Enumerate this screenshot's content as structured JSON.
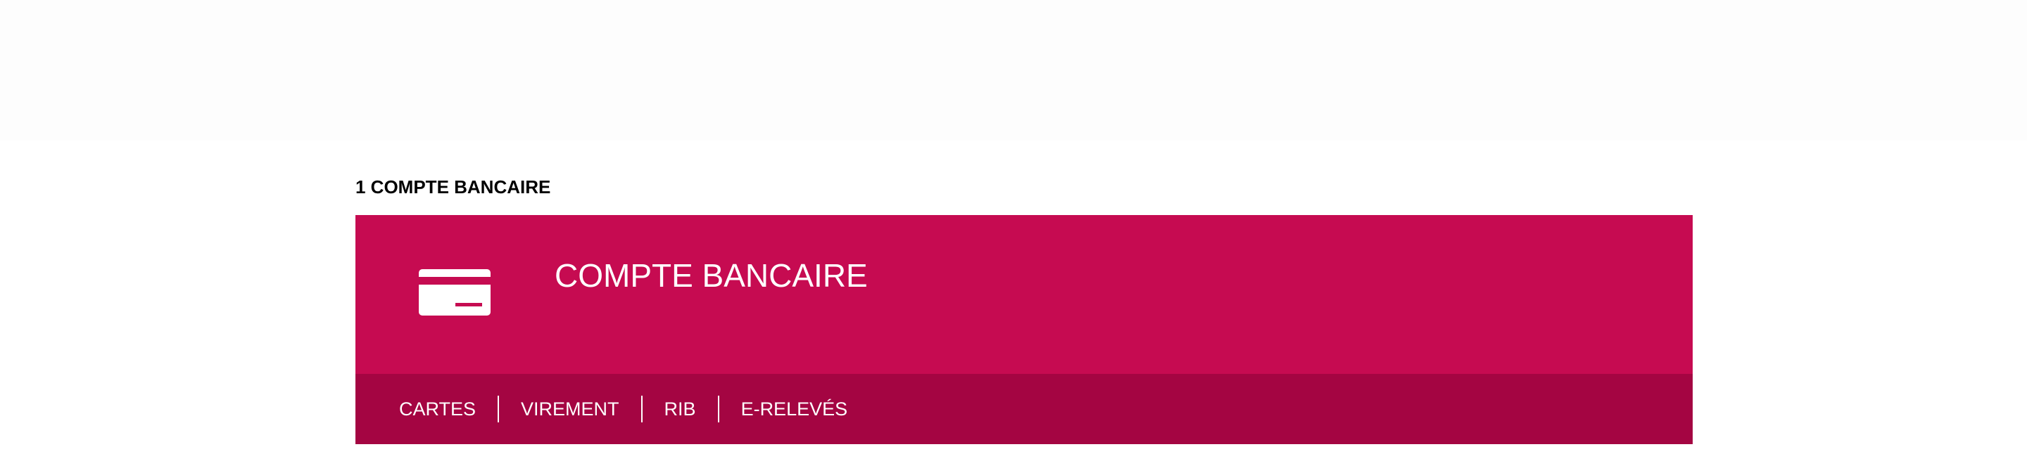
{
  "section": {
    "title": "1 COMPTE BANCAIRE"
  },
  "account": {
    "icon": "credit-card-icon",
    "title": "COMPTE BANCAIRE",
    "accent_color": "#c60b51",
    "nav_color": "#a40542",
    "nav": [
      {
        "label": "CARTES"
      },
      {
        "label": "VIREMENT"
      },
      {
        "label": "RIB"
      },
      {
        "label": "E-RELEVÉS"
      }
    ]
  }
}
